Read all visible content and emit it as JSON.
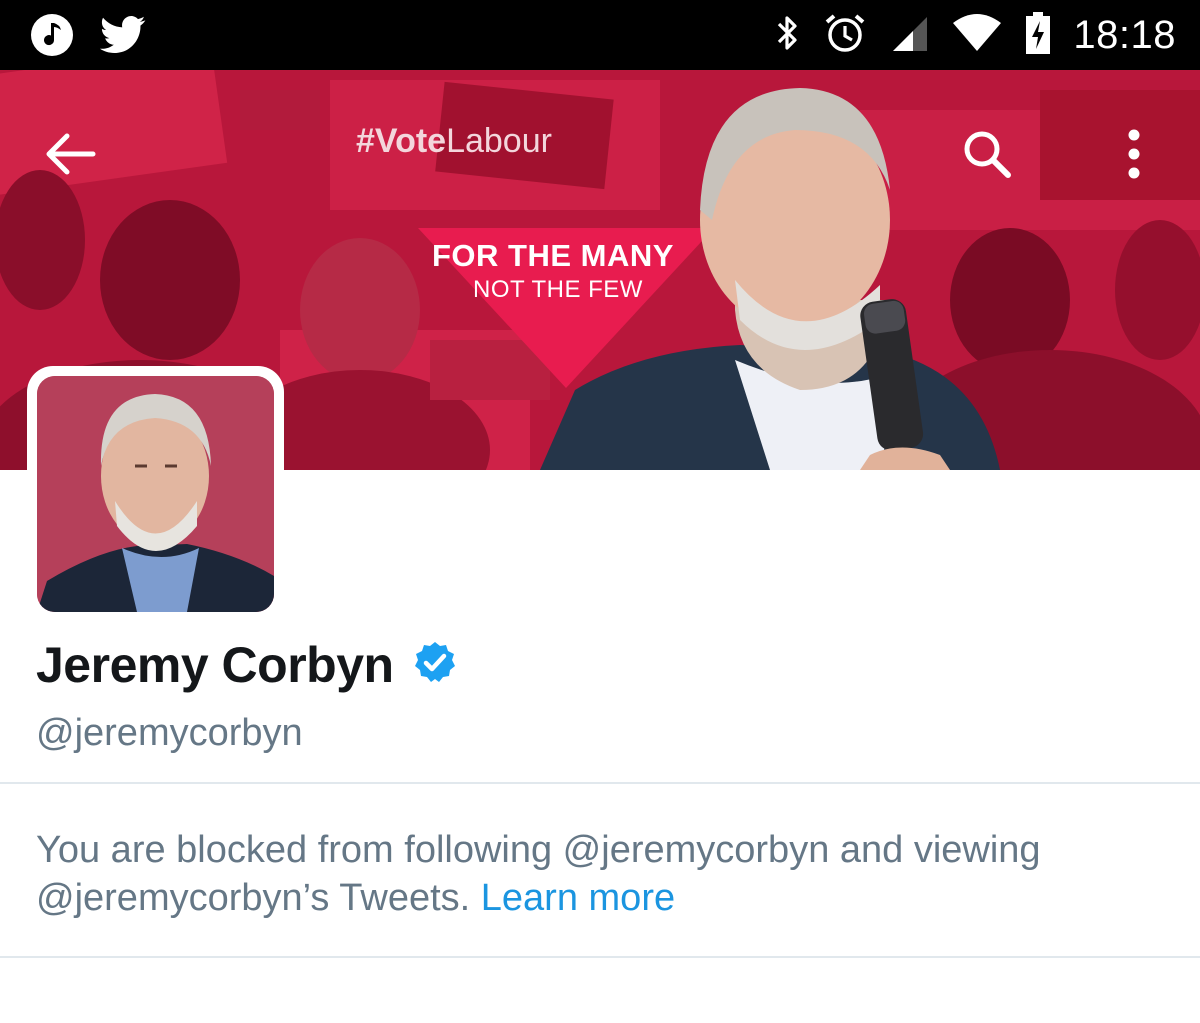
{
  "status_bar": {
    "time": "18:18",
    "left_icons": [
      "music-note-icon",
      "twitter-bird-icon"
    ],
    "right_icons": [
      "bluetooth-icon",
      "alarm-clock-icon",
      "cell-signal-icon",
      "wifi-icon",
      "battery-charging-icon"
    ]
  },
  "header": {
    "hashtag_bold": "#Vote",
    "hashtag_rest": "Labour",
    "slogan_line1": "FOR THE MANY",
    "slogan_line2": "NOT THE FEW",
    "back_icon": "arrow-left-icon",
    "search_icon": "search-icon",
    "more_icon": "more-vertical-icon"
  },
  "profile": {
    "name": "Jeremy Corbyn",
    "handle": "@jeremycorbyn",
    "verified": true
  },
  "blocked_notice": {
    "text": "You are blocked from following @jeremycorbyn and viewing @jeremycorbyn’s Tweets.",
    "link_label": "Learn more"
  },
  "colors": {
    "brand_red": "#c41b42",
    "link_blue": "#1b95e0",
    "verified_blue": "#1da1f2",
    "secondary_text": "#657786",
    "primary_text": "#14171a"
  }
}
